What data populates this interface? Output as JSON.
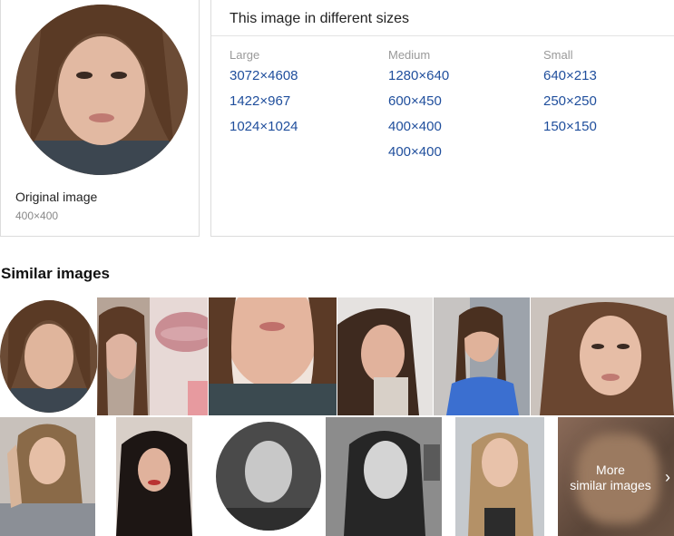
{
  "original": {
    "label": "Original image",
    "size": "400×400"
  },
  "sizes": {
    "title": "This image in different sizes",
    "large": {
      "header": "Large",
      "items": [
        "3072×4608",
        "1422×967",
        "1024×1024"
      ]
    },
    "medium": {
      "header": "Medium",
      "items": [
        "1280×640",
        "600×450",
        "400×400",
        "400×400"
      ]
    },
    "small": {
      "header": "Small",
      "items": [
        "640×213",
        "250×250",
        "150×150"
      ]
    }
  },
  "similar": {
    "title": "Similar images",
    "more_line1": "More",
    "more_line2": "similar images",
    "more_icon": "chevron-right-icon"
  }
}
